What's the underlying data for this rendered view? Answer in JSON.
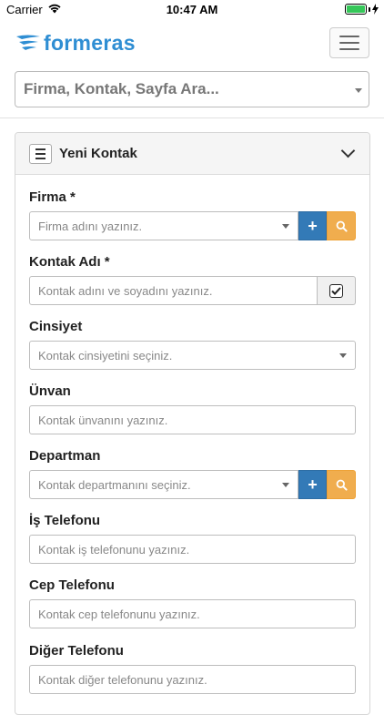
{
  "status_bar": {
    "carrier": "Carrier",
    "time": "10:47 AM",
    "wifi_icon": "wifi-icon",
    "battery_icon": "battery-icon",
    "battery_level": 1.0
  },
  "header": {
    "logo_text": "formeras",
    "brand_color": "#2f8ed3",
    "menu_icon": "hamburger-icon",
    "search": {
      "placeholder": "Firma, Kontak, Sayfa Ara..."
    }
  },
  "panel": {
    "title": "Yeni Kontak",
    "collapse_icon": "chevron-down-icon",
    "fields": [
      {
        "label": "Firma *",
        "placeholder": "Firma adını yazınız.",
        "type": "select-with-add-search"
      },
      {
        "label": "Kontak Adı *",
        "placeholder": "Kontak adını ve soyadını yazınız.",
        "type": "text-with-checkbox",
        "checked": true
      },
      {
        "label": "Cinsiyet",
        "placeholder": "Kontak cinsiyetini seçiniz.",
        "type": "select"
      },
      {
        "label": "Ünvan",
        "placeholder": "Kontak ünvanını yazınız.",
        "type": "text"
      },
      {
        "label": "Departman",
        "placeholder": "Kontak departmanını seçiniz.",
        "type": "select-with-add-search"
      },
      {
        "label": "İş Telefonu",
        "placeholder": "Kontak iş telefonunu yazınız.",
        "type": "text"
      },
      {
        "label": "Cep Telefonu",
        "placeholder": "Kontak cep telefonunu yazınız.",
        "type": "text"
      },
      {
        "label": "Diğer Telefonu",
        "placeholder": "Kontak diğer telefonunu yazınız.",
        "type": "text"
      }
    ],
    "add_button_label": "+",
    "colors": {
      "add_button": "#337ab7",
      "search_button": "#f0ad4e"
    }
  }
}
